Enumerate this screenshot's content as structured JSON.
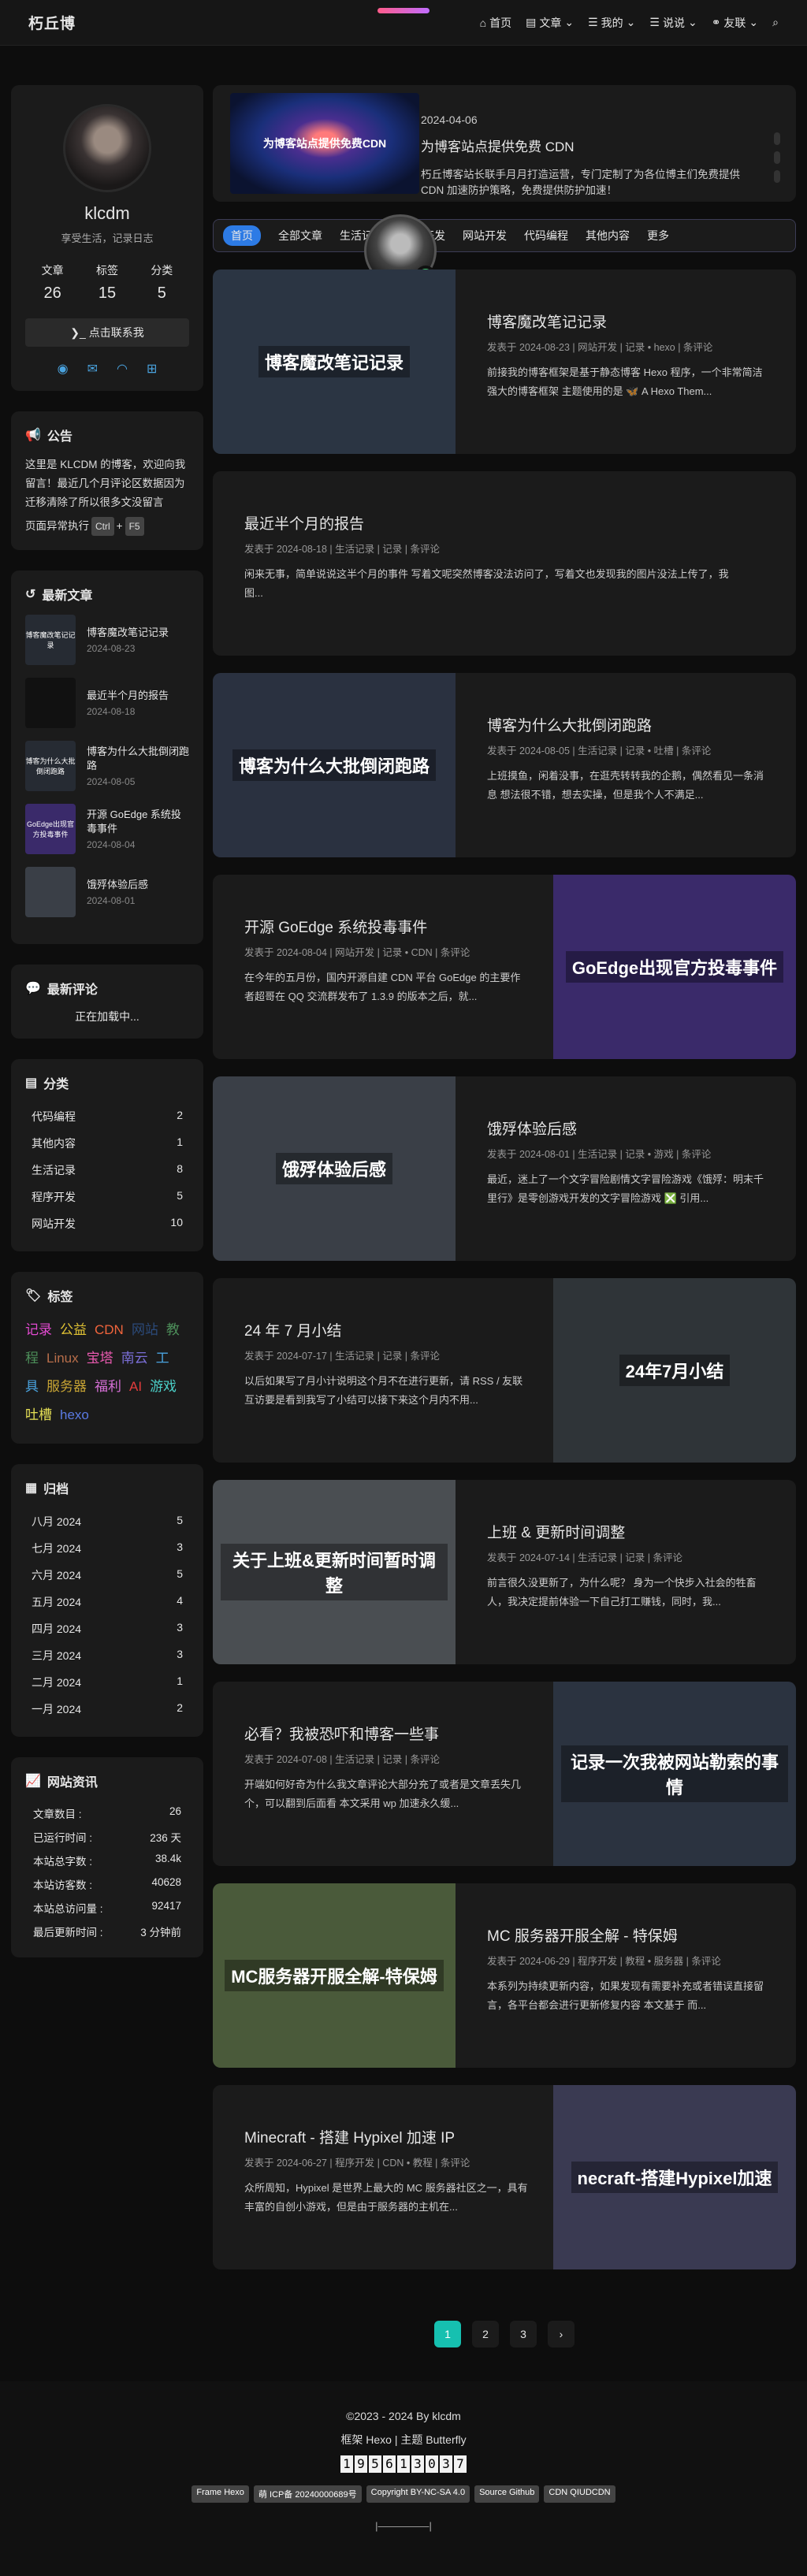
{
  "nav": {
    "brand": "朽丘博",
    "items": [
      "首页",
      "文章",
      "我的",
      "说说",
      "友联"
    ]
  },
  "profile": {
    "name": "klcdm",
    "motto": "享受生活，记录日志",
    "stats": [
      {
        "label": "文章",
        "value": "26"
      },
      {
        "label": "标签",
        "value": "15"
      },
      {
        "label": "分类",
        "value": "5"
      }
    ],
    "contact_label": "点击联系我"
  },
  "announcement": {
    "title": "公告",
    "text": "这里是 KLCDM 的博客，欢迎向我留言！最近几个月评论区数据因为迁移清除了所以很多文没留言",
    "shortcut_prefix": "页面异常执行",
    "key1": "Ctrl",
    "key2": "F5"
  },
  "recent": {
    "title": "最新文章",
    "items": [
      {
        "title": "博客魔改笔记记录",
        "date": "2024-08-23",
        "thumb": "博客魔改笔记记录"
      },
      {
        "title": "最近半个月的报告",
        "date": "2024-08-18",
        "thumb": ""
      },
      {
        "title": "博客为什么大批倒闭跑路",
        "date": "2024-08-05",
        "thumb": "博客为什么大批倒闭跑路"
      },
      {
        "title": "开源 GoEdge 系统投毒事件",
        "date": "2024-08-04",
        "thumb": "GoEdge出现官方投毒事件"
      },
      {
        "title": "饿殍体验后感",
        "date": "2024-08-01",
        "thumb": ""
      }
    ]
  },
  "comments": {
    "title": "最新评论",
    "text": "正在加载中..."
  },
  "categories": {
    "title": "分类",
    "items": [
      {
        "name": "代码编程",
        "count": "2"
      },
      {
        "name": "其他内容",
        "count": "1"
      },
      {
        "name": "生活记录",
        "count": "8"
      },
      {
        "name": "程序开发",
        "count": "5"
      },
      {
        "name": "网站开发",
        "count": "10"
      }
    ]
  },
  "tags": {
    "title": "标签",
    "items": [
      {
        "name": "记录",
        "color": "#e34ad1"
      },
      {
        "name": "公益",
        "color": "#e0c234"
      },
      {
        "name": "CDN",
        "color": "#f0643c"
      },
      {
        "name": "网站",
        "color": "#2b4a7a"
      },
      {
        "name": "教程",
        "color": "#4d8f5a"
      },
      {
        "name": "Linux",
        "color": "#b86e4a"
      },
      {
        "name": "宝塔",
        "color": "#ea5ab0"
      },
      {
        "name": "南云",
        "color": "#7b6fd8"
      },
      {
        "name": "工具",
        "color": "#4aa3df"
      },
      {
        "name": "服务器",
        "color": "#c9a534"
      },
      {
        "name": "福利",
        "color": "#d66fd6"
      },
      {
        "name": "AI",
        "color": "#e33c3c"
      },
      {
        "name": "游戏",
        "color": "#4bd0c8"
      },
      {
        "name": "吐槽",
        "color": "#e6e055"
      },
      {
        "name": "hexo",
        "color": "#5a7ae3"
      }
    ]
  },
  "archives": {
    "title": "归档",
    "items": [
      {
        "month": "八月 2024",
        "count": "5"
      },
      {
        "month": "七月 2024",
        "count": "3"
      },
      {
        "month": "六月 2024",
        "count": "5"
      },
      {
        "month": "五月 2024",
        "count": "4"
      },
      {
        "month": "四月 2024",
        "count": "3"
      },
      {
        "month": "三月 2024",
        "count": "3"
      },
      {
        "month": "二月 2024",
        "count": "1"
      },
      {
        "month": "一月 2024",
        "count": "2"
      }
    ]
  },
  "siteinfo": {
    "title": "网站资讯",
    "items": [
      {
        "k": "文章数目 :",
        "v": "26"
      },
      {
        "k": "已运行时间 :",
        "v": "236 天"
      },
      {
        "k": "本站总字数 :",
        "v": "38.4k"
      },
      {
        "k": "本站访客数 :",
        "v": "40628"
      },
      {
        "k": "本站总访问量 :",
        "v": "92417"
      },
      {
        "k": "最后更新时间 :",
        "v": "3 分钟前"
      }
    ]
  },
  "hero": {
    "image_text": "为博客站点提供免费CDN",
    "date": "2024-04-06",
    "title": "为博客站点提供免费 CDN",
    "desc": "朽丘博客站长联手月月打造运营，专门定制了为各位博主们免费提供 CDN 加速防护策略，免费提供防护加速！"
  },
  "catbar": [
    "首页",
    "全部文章",
    "生活记录",
    "程序开发",
    "网站开发",
    "代码编程",
    "其他内容",
    "更多"
  ],
  "posts": [
    {
      "side": "l",
      "title": "博客魔改笔记记录",
      "cover": "博客魔改笔记记录",
      "cover_bg": "#2b3543",
      "meta": "发表于 2024-08-23 | 网站开发 | 记录 • hexo | 条评论",
      "excerpt": "前接我的博客框架是基于静态博客 Hexo 程序，一个非常简洁强大的博客框架 主题使用的是 🦋 A Hexo Them..."
    },
    {
      "side": "none",
      "title": "最近半个月的报告",
      "cover": "",
      "cover_bg": "",
      "meta": "发表于 2024-08-18 | 生活记录 | 记录 | 条评论",
      "excerpt": "闲来无事，简单说说这半个月的事件 写着文呢突然博客没法访问了，写着文也发现我的图片没法上传了，我图..."
    },
    {
      "side": "l",
      "title": "博客为什么大批倒闭跑路",
      "cover": "博客为什么大批倒闭跑路",
      "cover_bg": "#2a3140",
      "meta": "发表于 2024-08-05 | 生活记录 | 记录 • 吐槽 | 条评论",
      "excerpt": "上班摸鱼，闲着没事，在逛壳转转我的企鹅，偶然看见一条消息 想法很不错，想去实操，但是我个人不满足..."
    },
    {
      "side": "r",
      "title": "开源 GoEdge 系统投毒事件",
      "cover": "GoEdge出现官方投毒事件",
      "cover_bg": "#3a2a6a",
      "meta": "发表于 2024-08-04 | 网站开发 | 记录 • CDN | 条评论",
      "excerpt": "在今年的五月份，国内开源自建 CDN 平台 GoEdge 的主要作者超哥在 QQ 交流群发布了 1.3.9 的版本之后，就..."
    },
    {
      "side": "l",
      "title": "饿殍体验后感",
      "cover": "饿殍体验后感",
      "cover_bg": "#3a3f47",
      "meta": "发表于 2024-08-01 | 生活记录 | 记录 • 游戏 | 条评论",
      "excerpt": "最近，迷上了一个文字冒险剧情文字冒险游戏《饿殍：明末千里行》是零创游戏开发的文字冒险游戏 ❎ 引用..."
    },
    {
      "side": "r",
      "title": "24 年 7 月小结",
      "cover": "24年7月小结",
      "cover_bg": "#2f3438",
      "meta": "发表于 2024-07-17 | 生活记录 | 记录 | 条评论",
      "excerpt": "以后如果写了月小计说明这个月不在进行更新，请 RSS / 友联互访要是看到我写了小结可以接下来这个月内不用..."
    },
    {
      "side": "l",
      "title": "上班 & 更新时间调整",
      "cover": "关于上班&更新时间暂时调整",
      "cover_bg": "#4a4e52",
      "meta": "发表于 2024-07-14 | 生活记录 | 记录 | 条评论",
      "excerpt": "前言很久没更新了，为什么呢？ 身为一个快步入社会的牲畜人，我决定提前体验一下自己打工赚钱，同时，我..."
    },
    {
      "side": "r",
      "title": "必看？我被恐吓和博客一些事",
      "cover": "记录一次我被网站勒索的事情",
      "cover_bg": "#2b3340",
      "meta": "发表于 2024-07-08 | 生活记录 | 记录 | 条评论",
      "excerpt": "开端如何好奇为什么我文章评论大部分充了或者是文章丢失几个，可以翻到后面看 本文采用 wp 加速永久缓..."
    },
    {
      "side": "l",
      "title": "MC 服务器开服全解 - 特保姆",
      "cover": "MC服务器开服全解-特保姆",
      "cover_bg": "#4a5a3a",
      "meta": "发表于 2024-06-29 | 程序开发 | 教程 • 服务器 | 条评论",
      "excerpt": "本系列为持续更新内容，如果发现有需要补充或者错误直接留言，各平台都会进行更新修复内容 本文基于 而..."
    },
    {
      "side": "r",
      "title": "Minecraft - 搭建 Hypixel 加速 IP",
      "cover": "necraft-搭建Hypixel加速",
      "cover_bg": "#3a3a52",
      "meta": "发表于 2024-06-27 | 程序开发 | CDN • 教程 | 条评论",
      "excerpt": "众所周知，Hypixel 是世界上最大的 MC 服务器社区之一，具有丰富的自创小游戏，但是由于服务器的主机在..."
    }
  ],
  "pager": [
    "1",
    "2",
    "3",
    "›"
  ],
  "footer": {
    "copyright": "©2023 - 2024 By klcdm",
    "framework": "框架 Hexo | 主题 Butterfly",
    "counter": [
      "1",
      "9",
      "5",
      "6",
      "1",
      "3",
      "0",
      "3",
      "7"
    ],
    "badges": [
      "Frame Hexo",
      "萌 ICP备 20240000689号",
      "Copyright BY-NC-SA 4.0",
      "Source Github",
      "CDN QIUDCDN"
    ],
    "last": "|—————|"
  }
}
